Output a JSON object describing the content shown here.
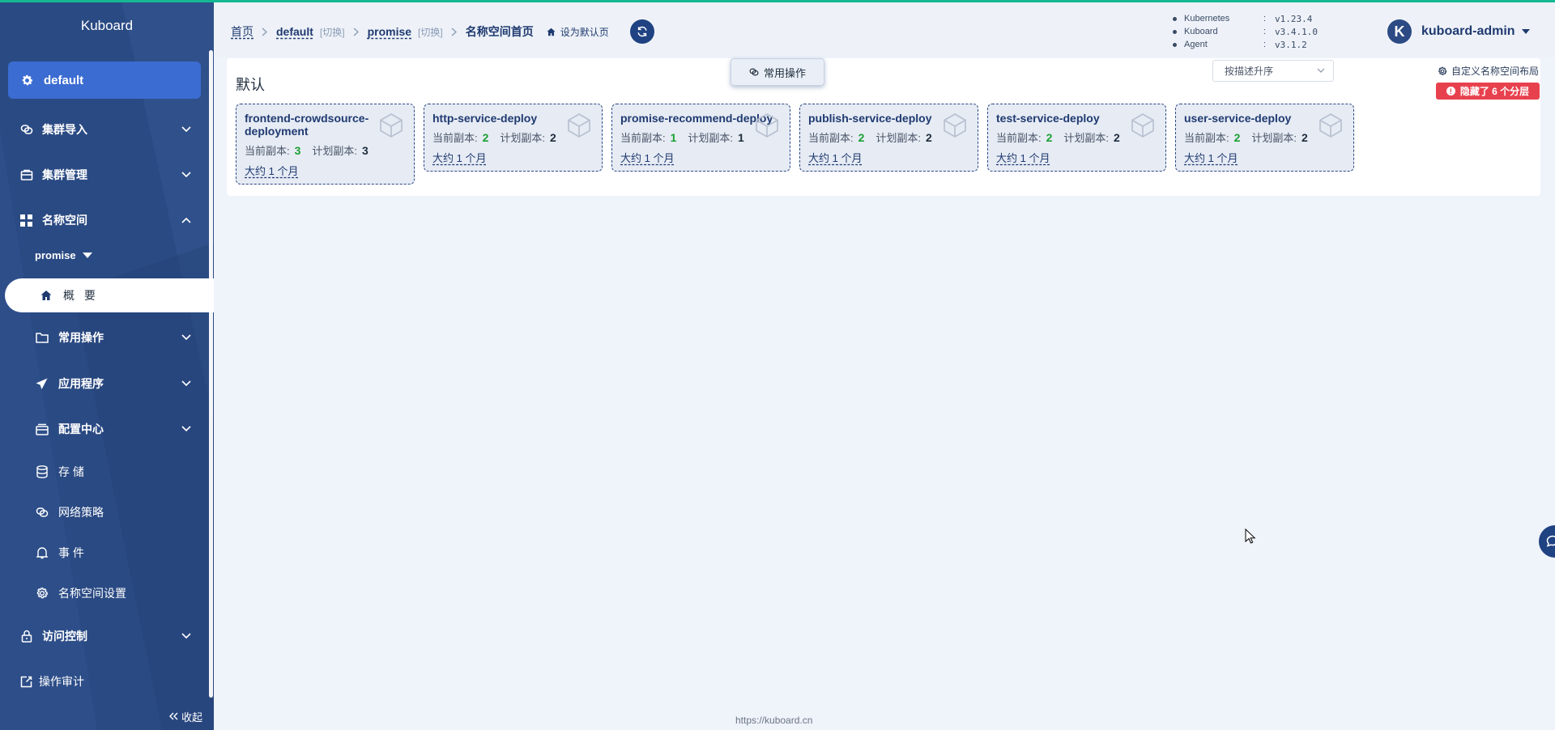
{
  "sidebar": {
    "brand": "Kuboard",
    "cluster": "default",
    "items": [
      {
        "label": "集群导入"
      },
      {
        "label": "集群管理"
      },
      {
        "label": "名称空间"
      }
    ],
    "namespace_select": "promise",
    "active_item": "概 要",
    "sub_items": [
      {
        "label": "常用操作"
      },
      {
        "label": "应用程序"
      },
      {
        "label": "配置中心"
      },
      {
        "label": "存 储"
      },
      {
        "label": "网络策略"
      },
      {
        "label": "事 件"
      },
      {
        "label": "名称空间设置"
      }
    ],
    "bottom_items": [
      {
        "label": "访问控制"
      },
      {
        "label": "操作审计"
      }
    ],
    "collapse_label": "收起"
  },
  "header": {
    "breadcrumb": {
      "home": "首页",
      "cluster": "default",
      "switch": "[切换]",
      "namespace": "promise",
      "current": "名称空间首页",
      "set_default": "设为默认页"
    },
    "versions": [
      {
        "name": "Kubernetes",
        "colon": ":",
        "value": "v1.23.4"
      },
      {
        "name": "Kuboard",
        "colon": ":",
        "value": "v3.4.1.0"
      },
      {
        "name": "Agent",
        "colon": ":",
        "value": "v3.1.2"
      }
    ],
    "user": {
      "avatar_letter": "K",
      "name": "kuboard-admin"
    }
  },
  "content": {
    "group_title": "默认",
    "common_ops": "常用操作",
    "sort_select": "按描述升序",
    "custom_layout": "自定义名称空间布局",
    "hidden_badge": "隐藏了 6 个分层",
    "current_label": "当前副本:",
    "planned_label": "计划副本:",
    "cards": [
      {
        "name": "frontend-crowdsource-deployment",
        "current": "3",
        "planned": "3",
        "age": "大约 1 个月"
      },
      {
        "name": "http-service-deploy",
        "current": "2",
        "planned": "2",
        "age": "大约 1 个月"
      },
      {
        "name": "promise-recommend-deploy",
        "current": "1",
        "planned": "1",
        "age": "大约 1 个月"
      },
      {
        "name": "publish-service-deploy",
        "current": "2",
        "planned": "2",
        "age": "大约 1 个月"
      },
      {
        "name": "test-service-deploy",
        "current": "2",
        "planned": "2",
        "age": "大约 1 个月"
      },
      {
        "name": "user-service-deploy",
        "current": "2",
        "planned": "2",
        "age": "大约 1 个月"
      }
    ]
  },
  "footer": {
    "url": "https://kuboard.cn"
  },
  "colors": {
    "sidebar_bg": "#2a4a83",
    "cluster_active": "#3b6cd2",
    "accent_line": "#14b892",
    "current_replicas": "#1aa032",
    "hidden_badge": "#e8414e"
  }
}
